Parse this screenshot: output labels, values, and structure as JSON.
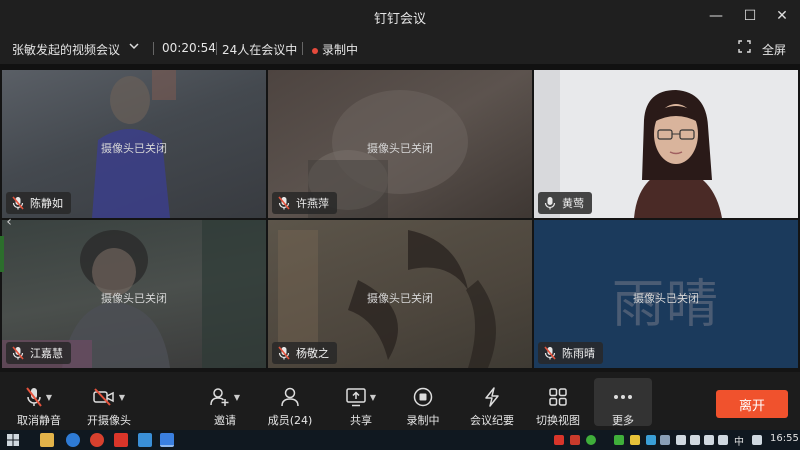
{
  "window": {
    "title": "钉钉会议",
    "minimize_label": "—",
    "maximize_label": "☐",
    "close_label": "✕"
  },
  "meeting": {
    "name": "张敏发起的视频会议",
    "duration": "00:20:54",
    "participant_status": "24人在会议中",
    "recording_status": "录制中",
    "fullscreen_label": "全屏"
  },
  "tiles": [
    {
      "name": "陈静如",
      "camera_status": "摄像头已关闭",
      "muted": true
    },
    {
      "name": "许燕萍",
      "camera_status": "摄像头已关闭",
      "muted": true
    },
    {
      "name": "黄莺",
      "camera_status": "",
      "muted": false
    },
    {
      "name": "江嘉慧",
      "camera_status": "摄像头已关闭",
      "muted": true
    },
    {
      "name": "杨敬之",
      "camera_status": "摄像头已关闭",
      "muted": true
    },
    {
      "name": "陈雨晴",
      "camera_status": "摄像头已关闭",
      "muted": true,
      "avatar_text": "雨晴"
    }
  ],
  "toolbar": {
    "unmute_label": "取消静音",
    "camera_label": "开摄像头",
    "invite_label": "邀请",
    "members_label": "成员(24)",
    "share_label": "共享",
    "recording_label": "录制中",
    "minutes_label": "会议纪要",
    "switch_view_label": "切换视图",
    "more_label": "更多",
    "leave_label": "离开"
  },
  "taskbar": {
    "ime_label": "中",
    "clock": "16:55"
  },
  "colors": {
    "leave_button": "#f0522d",
    "recording_dot": "#e54a3c",
    "muted_mic": "#e5533d",
    "avatar_tile_bg": "#1b3a5c"
  }
}
